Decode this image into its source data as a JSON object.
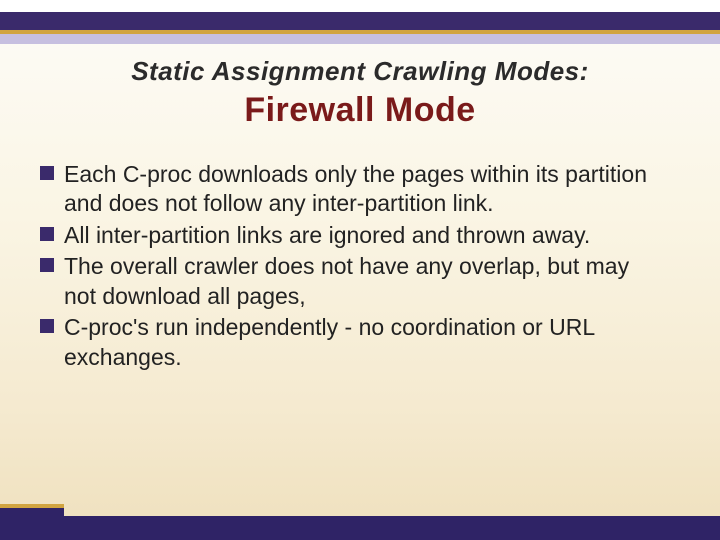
{
  "title": {
    "line1": "Static Assignment Crawling Modes:",
    "line2": "Firewall Mode"
  },
  "bullets": [
    "Each C-proc downloads only the pages within its partition and does not follow any inter-partition link.",
    "All inter-partition links are ignored and thrown away.",
    "The overall crawler does not have any overlap, but may not download all pages,",
    "C-proc's run  independently - no coordination or URL exchanges."
  ],
  "colors": {
    "accent_purple": "#3a2a6b",
    "accent_gold": "#d1a440",
    "title_red": "#7a1a1a"
  }
}
